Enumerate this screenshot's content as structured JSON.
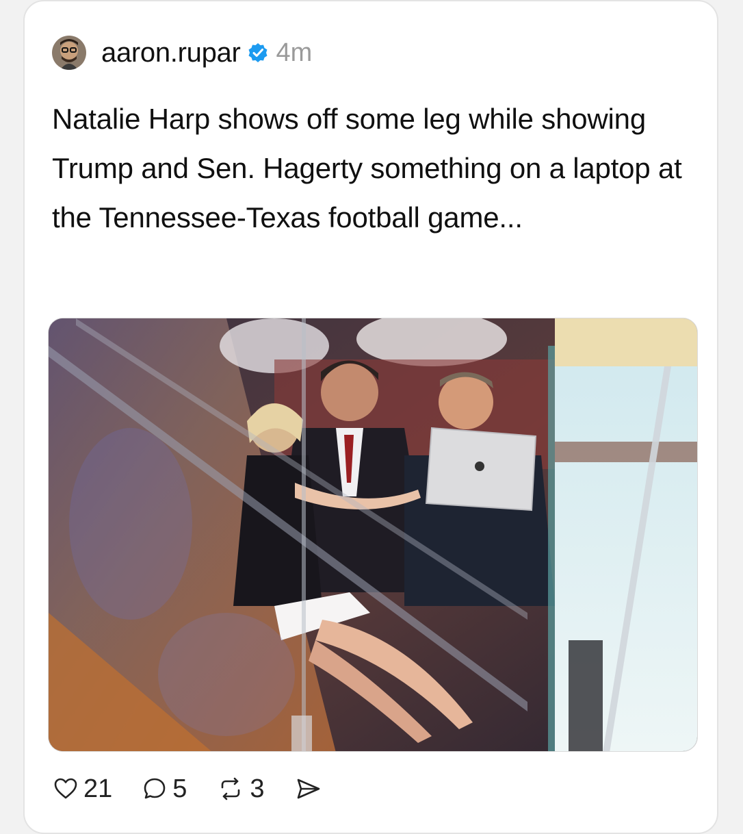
{
  "post": {
    "author": {
      "username": "aaron.rupar",
      "verified": true,
      "avatar": "avatar-photo"
    },
    "time": "4m",
    "text": "Natalie Harp shows off some leg while showing Trump and Sen. Hagerty something on a laptop at the Tennessee-Texas football game...",
    "media": {
      "type": "photo",
      "subject": "people seated in a stadium suite behind glass looking at a laptop"
    }
  },
  "actions": {
    "like": {
      "icon": "heart-icon",
      "count": "21"
    },
    "reply": {
      "icon": "comment-icon",
      "count": "5"
    },
    "repost": {
      "icon": "repost-icon",
      "count": "3"
    },
    "share": {
      "icon": "send-icon"
    }
  },
  "colors": {
    "verified_badge": "#1d9bf0",
    "text": "#101010",
    "muted": "#9a9a9a",
    "card_border": "#e3e3e3"
  }
}
